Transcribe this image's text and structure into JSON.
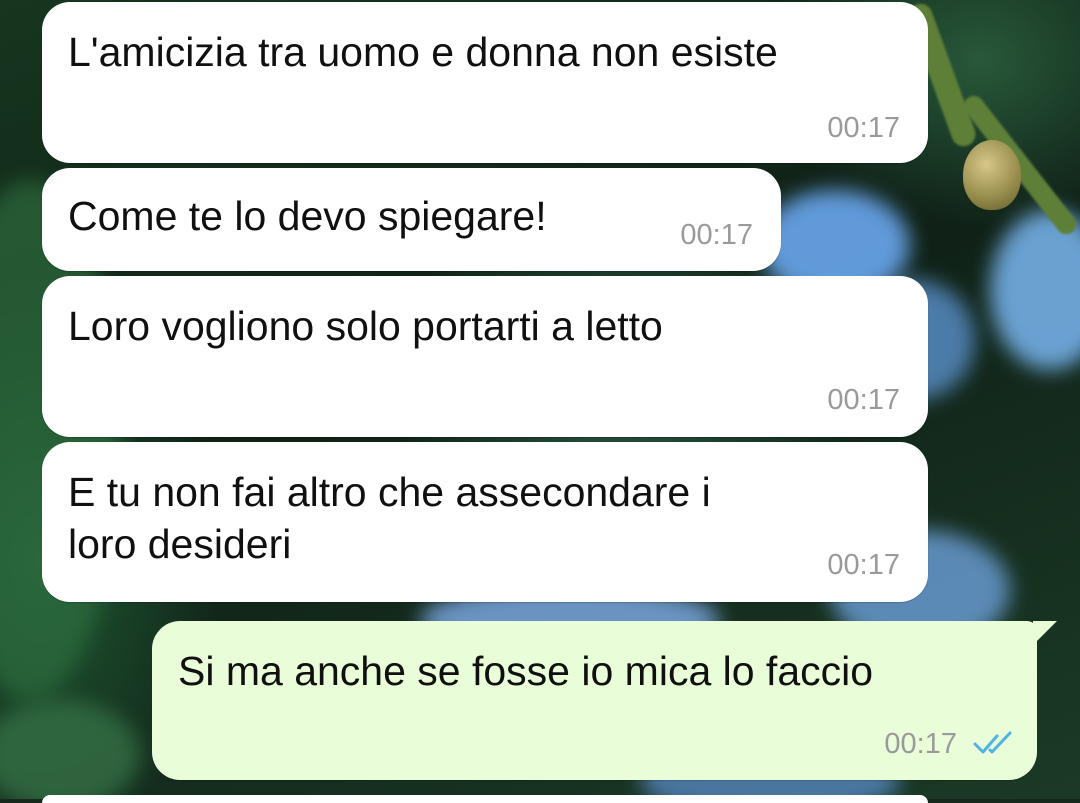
{
  "chat": {
    "messages": [
      {
        "direction": "in",
        "text": "L'amicizia tra uomo e donna non esiste",
        "time": "00:17"
      },
      {
        "direction": "in",
        "text": "Come te lo devo spiegare!",
        "time": "00:17"
      },
      {
        "direction": "in",
        "text": "Loro vogliono solo portarti a letto",
        "time": "00:17"
      },
      {
        "direction": "in",
        "text": "E tu non fai altro che assecondare i\nloro desideri",
        "time": "00:17"
      },
      {
        "direction": "out",
        "text": "Si ma anche se fosse io mica lo faccio",
        "time": "00:17",
        "status_icon": "double-check-icon",
        "status_color": "#4fb3e8"
      }
    ]
  },
  "colors": {
    "incoming_bubble": "#ffffff",
    "outgoing_bubble": "#e8fdd8",
    "timestamp": "#9a9a9a",
    "read_check": "#4fb3e8"
  }
}
